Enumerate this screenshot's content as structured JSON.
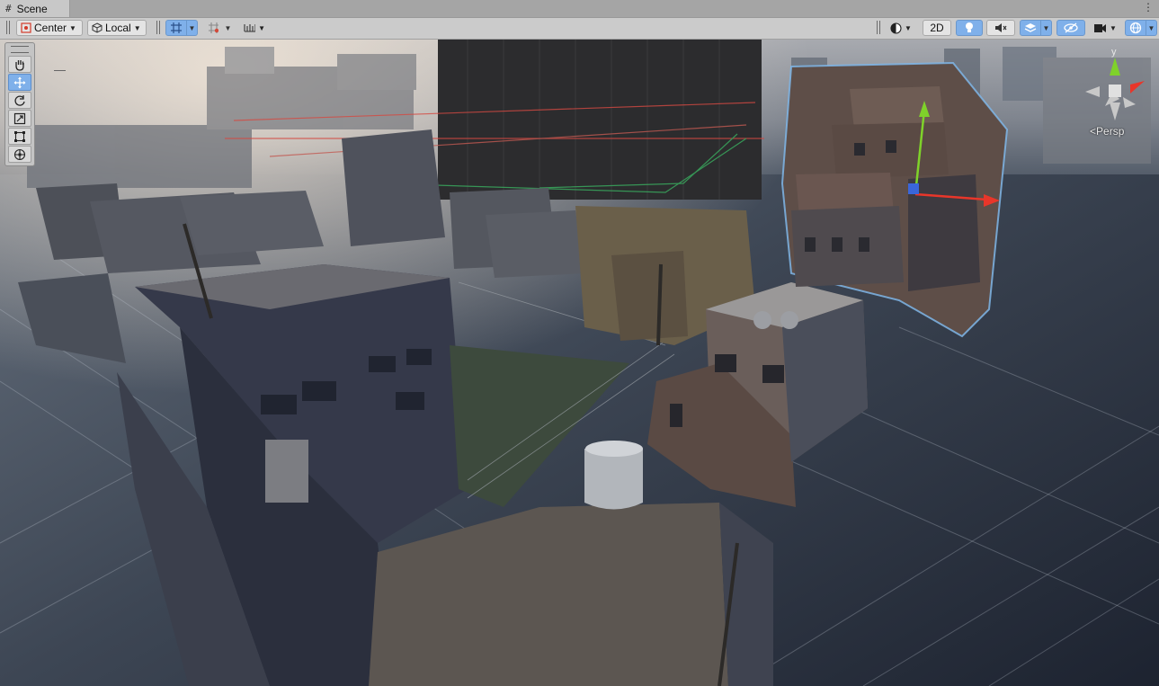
{
  "window": {
    "tab_title": "Scene",
    "tab_icon": "hash-icon",
    "menu_icon": "vertical-dots-icon"
  },
  "toolbar": {
    "pivot_mode": "Center",
    "pivot_rotation": "Local",
    "mode_2d": "2D",
    "icons": {
      "pivot": "pivot-icon",
      "rotation": "local-cube-icon",
      "grid_snap": "grid-snap-icon",
      "increment_snap": "increment-snap-icon",
      "ruler": "ruler-icon",
      "shading": "shading-sphere-icon",
      "lighting": "lightbulb-icon",
      "audio": "audio-mute-icon",
      "effects": "effects-layers-icon",
      "hidden": "scene-visibility-icon",
      "camera": "camera-icon",
      "gizmos": "gizmos-globe-icon"
    },
    "accent_color": "#7fb0ea"
  },
  "tools": [
    {
      "name": "hand-tool",
      "icon": "hand-icon",
      "active": false
    },
    {
      "name": "move-tool",
      "icon": "move-arrows-icon",
      "active": true
    },
    {
      "name": "rotate-tool",
      "icon": "rotate-icon",
      "active": false
    },
    {
      "name": "scale-tool",
      "icon": "scale-icon",
      "active": false
    },
    {
      "name": "rect-tool",
      "icon": "rect-transform-icon",
      "active": false
    },
    {
      "name": "transform-tool",
      "icon": "transform-all-icon",
      "active": false
    }
  ],
  "viewport": {
    "camera_mode": "Persp",
    "gizmo_axis_y": "y",
    "axis_colors": {
      "x": "#e8362a",
      "y": "#7fd22a",
      "z": "#3a66d9"
    },
    "selection_outline_color": "#7fb6e8"
  }
}
